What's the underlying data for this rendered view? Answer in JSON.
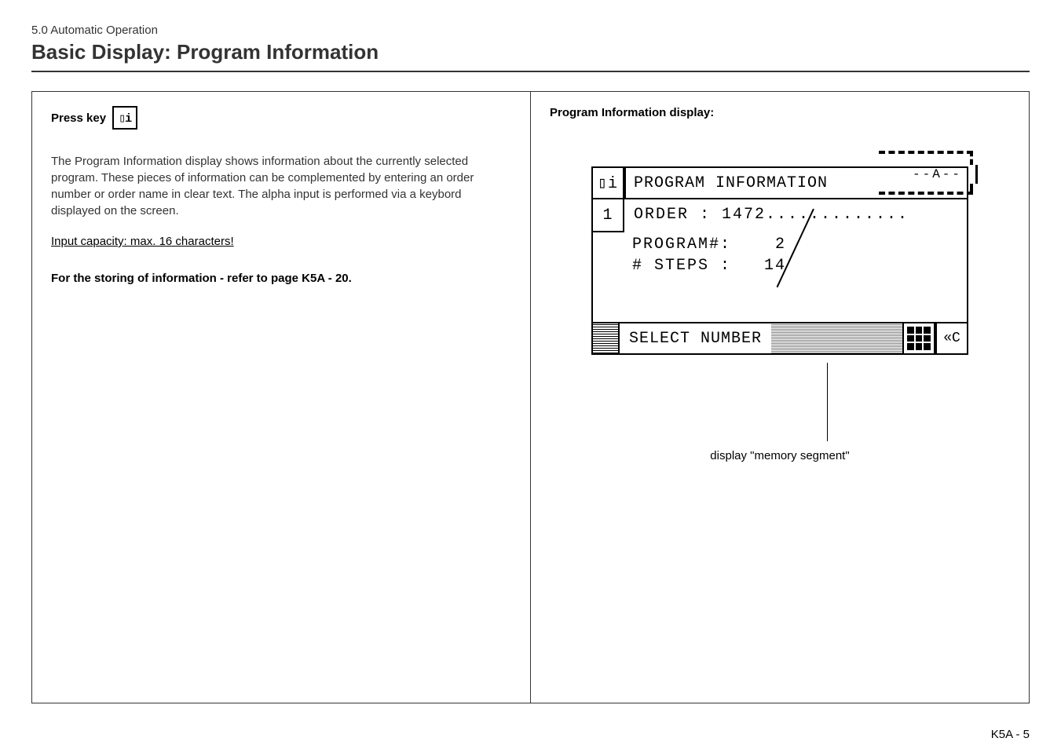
{
  "section_label": "5.0 Automatic Operation",
  "page_title": "Basic Display: Program Information",
  "left": {
    "press_key": "Press key",
    "key_glyph": "▯i",
    "paragraph": "The Program Information display shows information about the currently selected program. These pieces of information can be complemented by entering an order number or order name in clear text. The alpha input is performed via a keybord displayed on the screen.",
    "input_capacity": "Input capacity: max. 16 characters!",
    "storing_ref": "For the storing of information - refer to page K5A - 20"
  },
  "right": {
    "heading": "Program Information display:",
    "lcd_title_icon": "▯i",
    "lcd_title": "PROGRAM INFORMATION",
    "memory_segment_label": "--A--",
    "index_box": "1",
    "order_line": "ORDER : 1472.............",
    "program_line": "PROGRAM#:    2",
    "steps_line": "# STEPS :   14",
    "footer_label": "SELECT NUMBER",
    "back_glyph": "«C",
    "caption": "display \"memory segment\""
  },
  "page_number": "K5A - 5"
}
